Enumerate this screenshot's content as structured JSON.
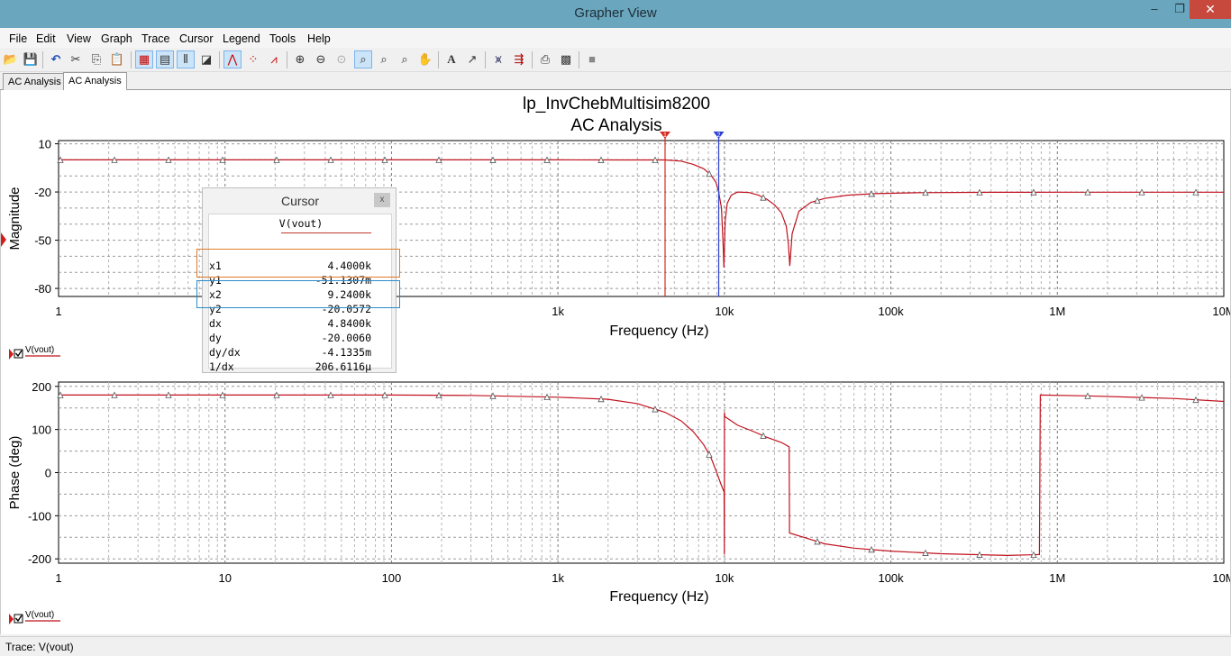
{
  "window": {
    "title": "Grapher View",
    "min": "–",
    "max": "❐",
    "close": "✕"
  },
  "menu": [
    "File",
    "Edit",
    "View",
    "Graph",
    "Trace",
    "Cursor",
    "Legend",
    "Tools",
    "Help"
  ],
  "tabs": [
    "AC Analysis",
    "AC Analysis"
  ],
  "graph": {
    "title_line1": "lp_InvChebMultisim8200",
    "title_line2": "AC Analysis"
  },
  "status": {
    "text": "Trace: V(vout)"
  },
  "cursor_window": {
    "title": "Cursor",
    "close": "x",
    "column": "V(vout)",
    "rows": [
      {
        "key": "x1",
        "value": "4.4000k"
      },
      {
        "key": "y1",
        "value": "-51.1307m"
      },
      {
        "key": "x2",
        "value": "9.2400k"
      },
      {
        "key": "y2",
        "value": "-20.0572"
      },
      {
        "key": "dx",
        "value": "4.8400k"
      },
      {
        "key": "dy",
        "value": "-20.0060"
      },
      {
        "key": "dy/dx",
        "value": "-4.1335m"
      },
      {
        "key": "1/dx",
        "value": "206.6116µ"
      }
    ]
  },
  "chart_data": [
    {
      "type": "line",
      "ylabel": "Magnitude",
      "xlabel": "Frequency (Hz)",
      "xscale": "log",
      "xlim": [
        1,
        10000000
      ],
      "ylim": [
        -85,
        12
      ],
      "yticks": [
        10,
        -20,
        -50,
        -80
      ],
      "xticks_visible": [
        "1",
        "1k",
        "10k",
        "100k",
        "1M",
        "10M"
      ],
      "legend": "V(vout)",
      "grid": true,
      "cursors": [
        {
          "name": "1",
          "x": 4400,
          "color": "#d62b1f"
        },
        {
          "name": "2",
          "x": 9240,
          "color": "#2c3fcf"
        }
      ],
      "series": [
        {
          "name": "V(vout)",
          "color": "#c0121e",
          "x": [
            1,
            100,
            1000,
            2500,
            4400,
            5500,
            6500,
            7500,
            8300,
            8900,
            9240,
            9600,
            9850,
            9930,
            10000,
            10100,
            10400,
            11000,
            12000,
            14000,
            16000,
            18000,
            20000,
            22000,
            23500,
            24200,
            24700,
            25500,
            28000,
            33000,
            40000,
            55000,
            80000,
            150000,
            400000,
            1000000,
            10000000
          ],
          "y": [
            0,
            0,
            -0.02,
            -0.03,
            -0.05,
            -0.8,
            -2.8,
            -5.5,
            -9.5,
            -14,
            -20.06,
            -30,
            -55,
            -67,
            -55,
            -38,
            -27,
            -22,
            -20,
            -20.3,
            -22,
            -24.5,
            -28,
            -33,
            -41,
            -52,
            -66,
            -46,
            -32,
            -26.5,
            -24,
            -22,
            -21,
            -20.4,
            -20.2,
            -20.1,
            -20.1
          ]
        }
      ]
    },
    {
      "type": "line",
      "ylabel": "Phase (deg)",
      "xlabel": "Frequency (Hz)",
      "xscale": "log",
      "xlim": [
        1,
        10000000
      ],
      "ylim": [
        -210,
        210
      ],
      "yticks": [
        200,
        100,
        0,
        -100,
        -200
      ],
      "xticks_visible": [
        "1",
        "10",
        "100",
        "1k",
        "10k",
        "100k",
        "1M",
        "10M"
      ],
      "legend": "V(vout)",
      "grid": true,
      "series": [
        {
          "name": "V(vout)",
          "color": "#c0121e",
          "x": [
            1,
            100,
            300,
            1000,
            2000,
            3000,
            4400,
            5500,
            6500,
            7500,
            8300,
            8900,
            9500,
            9950,
            9990,
            10000,
            10050,
            12000,
            15000,
            18000,
            22000,
            24500,
            24600,
            30000,
            40000,
            60000,
            100000,
            200000,
            500000,
            780000,
            790000,
            1500000,
            5000000,
            10000000
          ],
          "y": [
            180,
            180,
            179,
            175,
            170,
            160,
            140,
            120,
            95,
            65,
            35,
            5,
            -25,
            -45,
            -190,
            140,
            130,
            110,
            95,
            82,
            70,
            60,
            -140,
            -150,
            -165,
            -175,
            -182,
            -188,
            -192,
            -190,
            180,
            178,
            172,
            165
          ]
        }
      ]
    }
  ]
}
